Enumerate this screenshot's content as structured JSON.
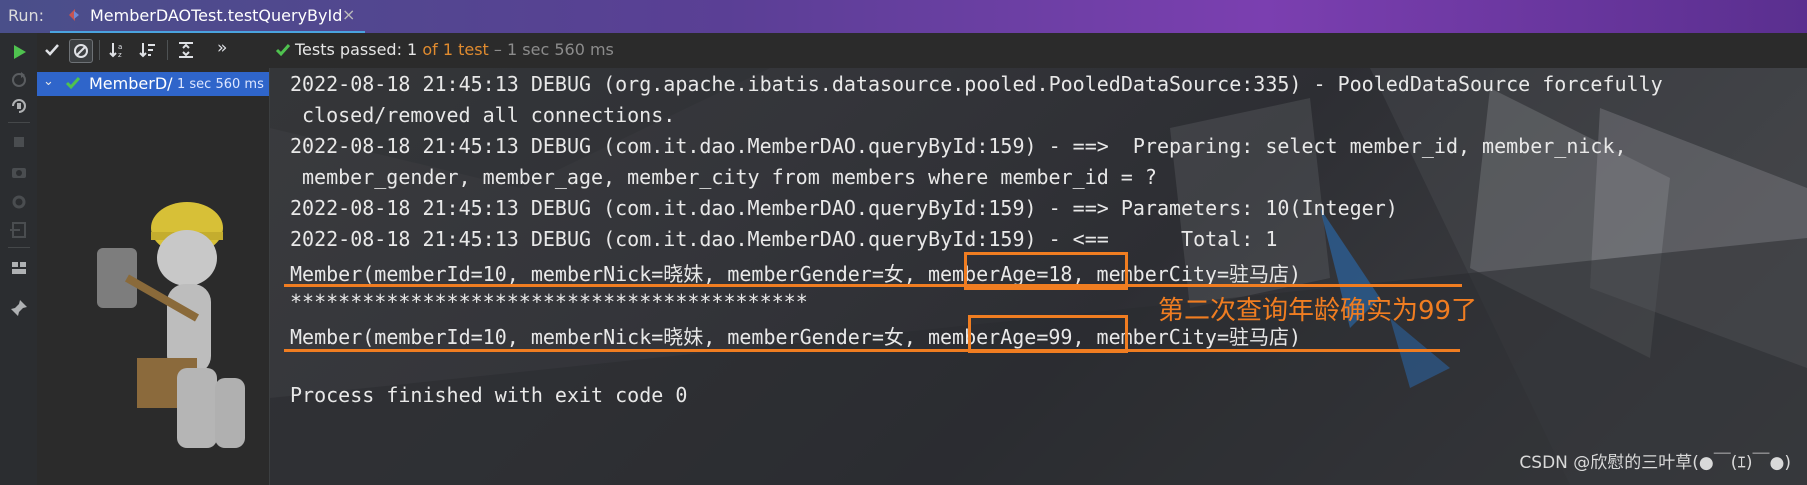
{
  "runbar": {
    "label": "Run:",
    "tab_title": "MemberDAOTest.testQueryById",
    "close_glyph": "×"
  },
  "toolbar": {
    "status_passed": "Tests passed:",
    "status_count": "1",
    "status_of": "of 1 test",
    "status_time": "– 1 sec 560 ms",
    "more": "»"
  },
  "tree": {
    "chevron": "⌄",
    "item_name": "MemberD/",
    "item_time": "1 sec 560 ms"
  },
  "console": {
    "lines": [
      "2022-08-18 21:45:13 DEBUG (org.apache.ibatis.datasource.pooled.PooledDataSource:335) - PooledDataSource forcefully",
      "closed/removed all connections.",
      "2022-08-18 21:45:13 DEBUG (com.it.dao.MemberDAO.queryById:159) - ==>  Preparing: select member_id, member_nick,",
      "member_gender, member_age, member_city from members where member_id = ?",
      "2022-08-18 21:45:13 DEBUG (com.it.dao.MemberDAO.queryById:159) - ==> Parameters: 10(Integer)",
      "2022-08-18 21:45:13 DEBUG (com.it.dao.MemberDAO.queryById:159) - <==      Total: 1",
      "Member(memberId=10, memberNick=晓妹, memberGender=女, memberAge=18, memberCity=驻马店)",
      "*******************************************",
      "Member(memberId=10, memberNick=晓妹, memberGender=女, memberAge=99, memberCity=驻马店)",
      "Process finished with exit code 0"
    ],
    "annotation": "第二次查询年龄确实为99了",
    "watermark": "CSDN @欣慰的三叶草(●￣(ｴ)￣●)"
  },
  "colors": {
    "accent_orange": "#f07d21",
    "pass_green": "#4fc24f",
    "selection_blue": "#2f65ca",
    "tab_underline": "#4aa3df"
  },
  "icons": {
    "sidebar": [
      "run-icon",
      "rerun-failed-icon",
      "toggle-auto-test-icon",
      "stop-icon",
      "camera-icon",
      "settings-icon",
      "export-icon",
      "layout-icon",
      "pin-icon"
    ],
    "toolbar": [
      "show-passed-icon",
      "show-ignored-icon",
      "sort-alphabetically-icon",
      "sort-by-duration-icon",
      "expand-all-icon",
      "more-icon"
    ]
  }
}
